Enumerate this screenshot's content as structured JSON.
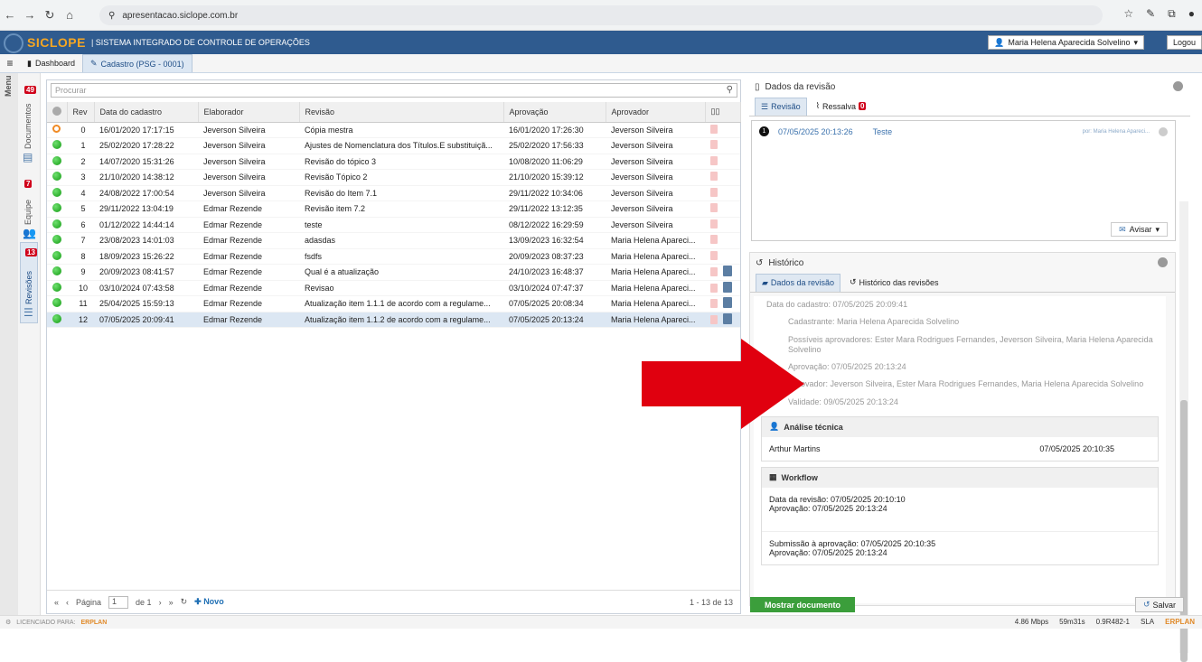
{
  "browser": {
    "url": "apresentacao.siclope.com.br"
  },
  "app": {
    "logo": "SICLOPE",
    "subtitle": "| SISTEMA INTEGRADO DE CONTROLE DE OPERAÇÕES",
    "user": "Maria Helena Aparecida Solvelino",
    "logout": "Logou"
  },
  "tabs": {
    "dashboard": "Dashboard",
    "cadastro": "Cadastro (PSG - 0001)"
  },
  "sidebar": {
    "menu": "Menu",
    "documentos": "Documentos",
    "documentos_badge": "49",
    "equipe": "Equipe",
    "equipe_badge": "7",
    "revisoes": "Revisões",
    "revisoes_badge": "13"
  },
  "grid": {
    "search_placeholder": "Procurar",
    "columns": [
      "Rev",
      "Data do cadastro",
      "Elaborador",
      "Revisão",
      "Aprovação",
      "Aprovador"
    ],
    "rows": [
      {
        "rev": "0",
        "data": "16/01/2020 17:17:15",
        "elab": "Jeverson Silveira",
        "revisao": "Cópia mestra",
        "aprov": "16/01/2020 17:26:30",
        "aprovador": "Jeverson Silveira"
      },
      {
        "rev": "1",
        "data": "25/02/2020 17:28:22",
        "elab": "Jeverson Silveira",
        "revisao": "Ajustes de Nomenclatura dos Títulos.E substituiçã...",
        "aprov": "25/02/2020 17:56:33",
        "aprovador": "Jeverson Silveira"
      },
      {
        "rev": "2",
        "data": "14/07/2020 15:31:26",
        "elab": "Jeverson Silveira",
        "revisao": "Revisão do tópico 3",
        "aprov": "10/08/2020 11:06:29",
        "aprovador": "Jeverson Silveira"
      },
      {
        "rev": "3",
        "data": "21/10/2020 14:38:12",
        "elab": "Jeverson Silveira",
        "revisao": "Revisão Tópico 2",
        "aprov": "21/10/2020 15:39:12",
        "aprovador": "Jeverson Silveira"
      },
      {
        "rev": "4",
        "data": "24/08/2022 17:00:54",
        "elab": "Jeverson Silveira",
        "revisao": "Revisão do Item 7.1",
        "aprov": "29/11/2022 10:34:06",
        "aprovador": "Jeverson Silveira"
      },
      {
        "rev": "5",
        "data": "29/11/2022 13:04:19",
        "elab": "Edmar Rezende",
        "revisao": "Revisão item 7.2",
        "aprov": "29/11/2022 13:12:35",
        "aprovador": "Jeverson Silveira"
      },
      {
        "rev": "6",
        "data": "01/12/2022 14:44:14",
        "elab": "Edmar Rezende",
        "revisao": "teste",
        "aprov": "08/12/2022 16:29:59",
        "aprovador": "Jeverson Silveira"
      },
      {
        "rev": "7",
        "data": "23/08/2023 14:01:03",
        "elab": "Edmar Rezende",
        "revisao": "adasdas",
        "aprov": "13/09/2023 16:32:54",
        "aprovador": "Maria Helena Apareci..."
      },
      {
        "rev": "8",
        "data": "18/09/2023 15:26:22",
        "elab": "Edmar Rezende",
        "revisao": "fsdfs",
        "aprov": "20/09/2023 08:37:23",
        "aprovador": "Maria Helena Apareci..."
      },
      {
        "rev": "9",
        "data": "20/09/2023 08:41:57",
        "elab": "Edmar Rezende",
        "revisao": "Qual é a atualização",
        "aprov": "24/10/2023 16:48:37",
        "aprovador": "Maria Helena Apareci..."
      },
      {
        "rev": "10",
        "data": "03/10/2024 07:43:58",
        "elab": "Edmar Rezende",
        "revisao": "Revisao",
        "aprov": "03/10/2024 07:47:37",
        "aprovador": "Maria Helena Apareci..."
      },
      {
        "rev": "11",
        "data": "25/04/2025 15:59:13",
        "elab": "Edmar Rezende",
        "revisao": "Atualização item 1.1.1 de acordo com a regulame...",
        "aprov": "07/05/2025 20:08:34",
        "aprovador": "Maria Helena Apareci..."
      },
      {
        "rev": "12",
        "data": "07/05/2025 20:09:41",
        "elab": "Edmar Rezende",
        "revisao": "Atualização item 1.1.2 de acordo com a regulame...",
        "aprov": "07/05/2025 20:13:24",
        "aprovador": "Maria Helena Apareci..."
      }
    ],
    "pager": {
      "page_label": "Página",
      "page_value": "1",
      "of": "de 1",
      "novo": "Novo",
      "count": "1 - 13 de 13"
    }
  },
  "right": {
    "title": "Dados da revisão",
    "tab_revisao": "Revisão",
    "tab_ressalva": "Ressalva",
    "ressalva_badge": "0",
    "entry": {
      "num": "1",
      "date": "07/05/2025 20:13:26",
      "text": "Teste",
      "by": "por: Maria Helena Apareci..."
    },
    "avisar": "Avisar",
    "historico": "Histórico",
    "htab_dados": "Dados da revisão",
    "htab_hist": "Histórico das revisões",
    "fields": [
      "Data do cadastro: 07/05/2025 20:09:41",
      "Cadastrante: Maria Helena Aparecida Solvelino",
      "Possíveis aprovadores: Ester Mara Rodrigues Fernandes, Jeverson Silveira, Maria Helena Aparecida Solvelino",
      "Aprovação: 07/05/2025 20:13:24",
      "Aprovador: Jeverson Silveira, Ester Mara Rodrigues Fernandes, Maria Helena Aparecida Solvelino",
      "Validade: 09/05/2025 20:13:24"
    ],
    "analise_title": "Análise técnica",
    "analise_name": "Arthur Martins",
    "analise_date": "07/05/2025 20:10:35",
    "workflow_title": "Workflow",
    "wf1a": "Data da revisão: 07/05/2025 20:10:10",
    "wf1b": "Aprovação: 07/05/2025 20:13:24",
    "wf2a": "Submissão à aprovação: 07/05/2025 20:10:35",
    "wf2b": "Aprovação: 07/05/2025 20:13:24"
  },
  "buttons": {
    "mostrar": "Mostrar documento",
    "salvar": "Salvar"
  },
  "footer": {
    "licenciado": "LICENCIADO PARA:",
    "brand": "ERPLAN",
    "speed": "4.86 Mbps",
    "time": "59m31s",
    "version": "0.9R482-1",
    "sla": "SLA",
    "brand2": "ERPLAN"
  }
}
